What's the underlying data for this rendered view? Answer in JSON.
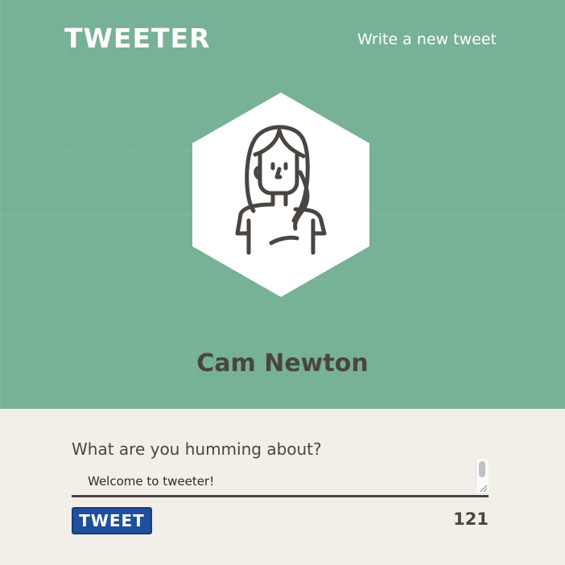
{
  "header": {
    "logo_text": "TWEETER",
    "compose_link": "Write a new tweet"
  },
  "profile": {
    "avatar_icon": "person-avatar-icon",
    "name": "Cam Newton"
  },
  "composer": {
    "label": "What are you humming about?",
    "value": "Welcome to tweeter!",
    "submit_label": "TWEET",
    "char_counter": "121"
  },
  "colors": {
    "header_bg": "#77b196",
    "page_bg": "#f2efe8",
    "text_dark": "#4a4541",
    "button_bg": "#1f4f9e"
  }
}
